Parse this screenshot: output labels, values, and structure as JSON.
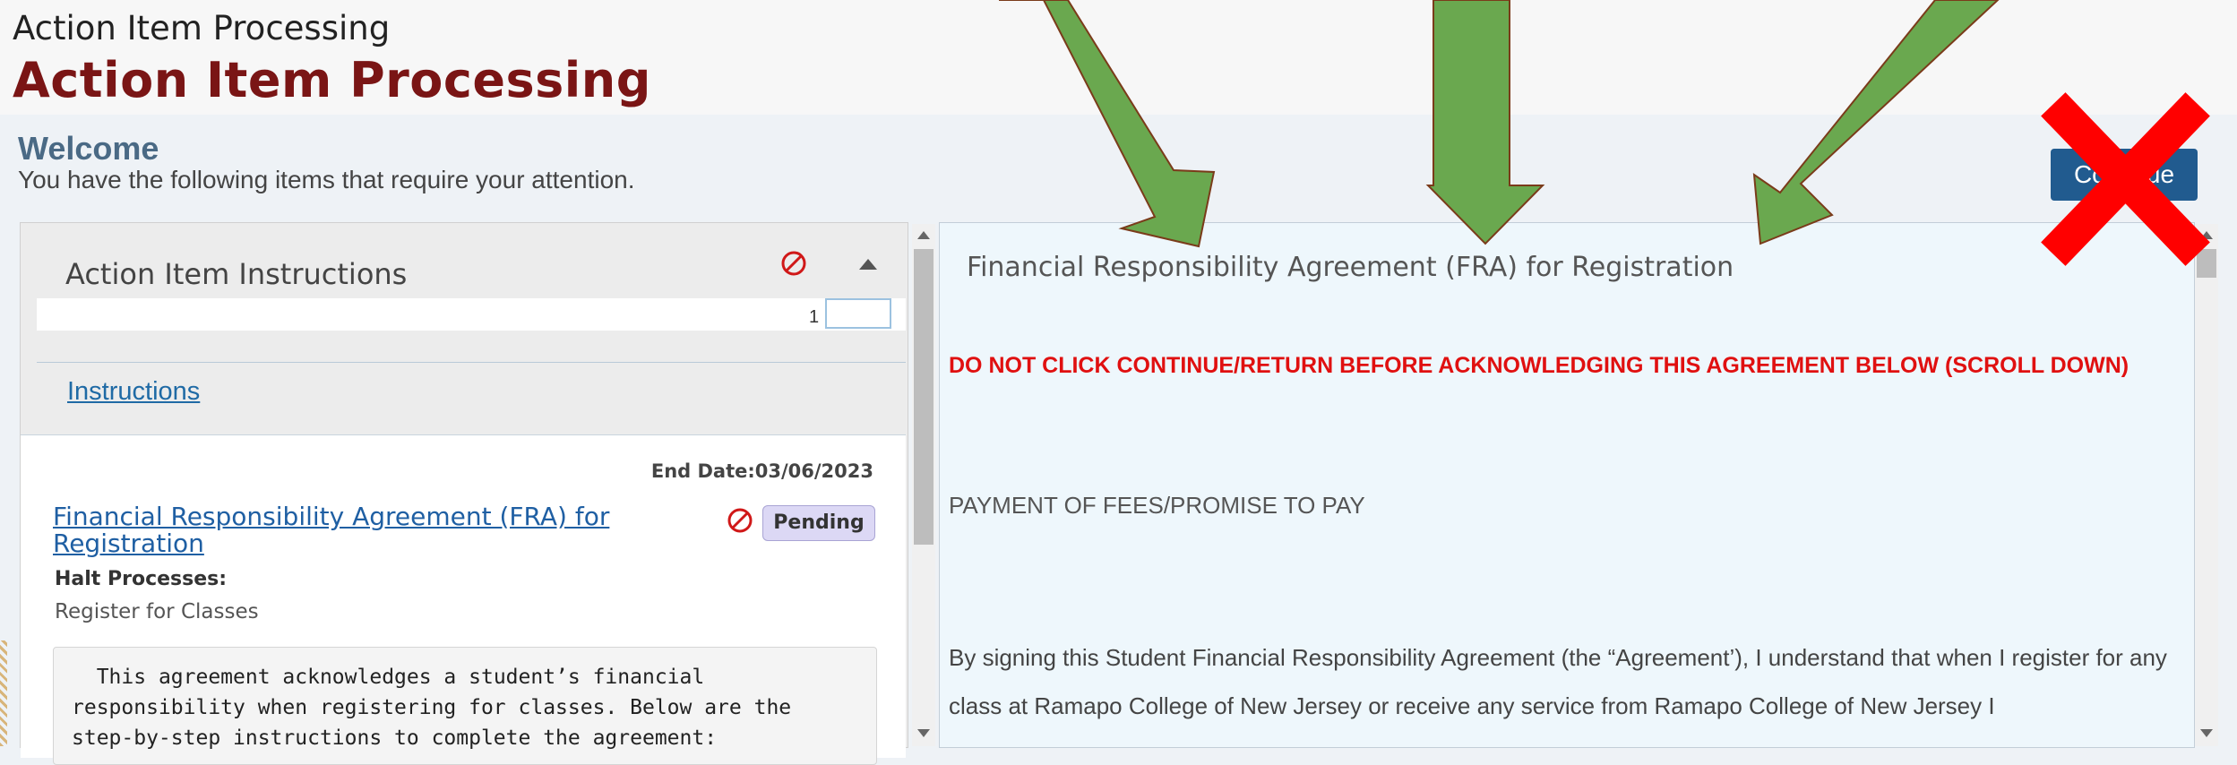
{
  "window": {
    "title": "Action Item Processing"
  },
  "page": {
    "title": "Action Item Processing"
  },
  "welcome": {
    "title": "Welcome",
    "subtitle": "You have the following items that require your attention."
  },
  "continue_button": {
    "label": "Continue"
  },
  "left_panel": {
    "title": "Action Item Instructions",
    "progress_count": "1",
    "instructions_link": "Instructions",
    "item": {
      "end_date": "End Date:03/06/2023",
      "title": "Financial Responsibility Agreement (FRA) for Registration",
      "status": "Pending",
      "halt_label": "Halt Processes:",
      "halt_value": "Register for Classes",
      "description": "  This agreement acknowledges a student’s financial\nresponsibility when registering for classes. Below are the\nstep-by-step instructions to complete the agreement:"
    }
  },
  "right_panel": {
    "title": "Financial Responsibility Agreement (FRA) for Registration",
    "warning": "DO NOT CLICK CONTINUE/RETURN BEFORE ACKNOWLEDGING THIS AGREEMENT BELOW (SCROLL DOWN)",
    "section_heading": "PAYMENT OF FEES/PROMISE TO PAY",
    "body": "By signing this Student Financial Responsibility Agreement (the “Agreement’), I understand that when I register for any class at Ramapo College of New Jersey or receive any service from Ramapo College of New Jersey I"
  },
  "colors": {
    "page_title": "#7a1515",
    "warning": "#e01010",
    "link": "#1f5fa3",
    "button": "#215b8f",
    "arrow": "#6aa84f",
    "cross": "#ff0000"
  },
  "icons": [
    "halt-icon",
    "collapse-icon",
    "green-arrow-icon",
    "red-x-icon"
  ]
}
